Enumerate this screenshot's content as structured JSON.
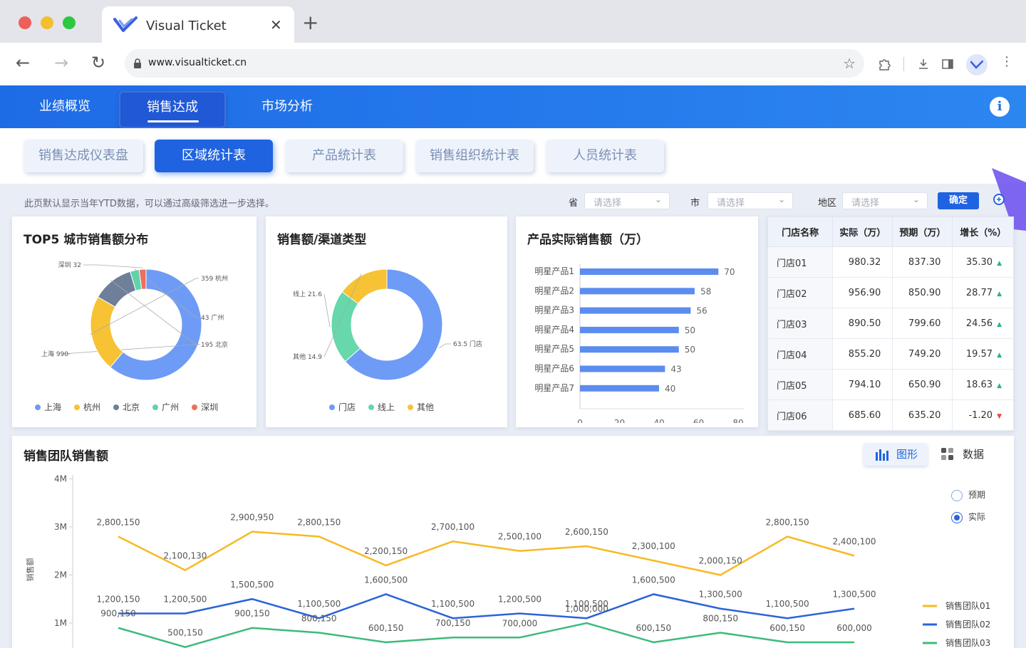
{
  "browser": {
    "tab_title": "Visual Ticket",
    "url": "www.visualticket.cn"
  },
  "nav": {
    "items": [
      "业绩概览",
      "销售达成",
      "市场分析"
    ],
    "active": 1
  },
  "subtabs": {
    "items": [
      "销售达成仪表盘",
      "区域统计表",
      "产品统计表",
      "销售组织统计表",
      "人员统计表"
    ],
    "active": 1
  },
  "filters": {
    "hint": "此页默认显示当年YTD数据，可以通过高级筛选进一步选择。",
    "province_label": "省",
    "city_label": "市",
    "district_label": "地区",
    "placeholder": "请选择",
    "confirm": "确定"
  },
  "cards": {
    "top5": {
      "title": "TOP5 城市销售额分布"
    },
    "channel": {
      "title": "销售额/渠道类型"
    },
    "product": {
      "title": "产品实际销售额（万）"
    }
  },
  "chart_data": [
    {
      "type": "pie",
      "title": "TOP5 城市销售额分布",
      "slices": [
        {
          "label": "上海",
          "value": 990,
          "color": "#6e9bf5"
        },
        {
          "label": "杭州",
          "value": 359,
          "color": "#f7c233"
        },
        {
          "label": "北京",
          "value": 195,
          "color": "#6f7f99"
        },
        {
          "label": "广州",
          "value": 43,
          "color": "#61d3a8"
        },
        {
          "label": "深圳",
          "value": 32,
          "color": "#ee6f5d"
        }
      ],
      "legend": [
        "上海",
        "杭州",
        "北京",
        "广州",
        "深圳"
      ]
    },
    {
      "type": "pie",
      "title": "销售额/渠道类型",
      "slices": [
        {
          "label": "门店",
          "value": 63.5,
          "color": "#6e9bf5"
        },
        {
          "label": "线上",
          "value": 21.6,
          "color": "#66d8aa"
        },
        {
          "label": "其他",
          "value": 14.9,
          "color": "#f7c233"
        }
      ],
      "legend": [
        "门店",
        "线上",
        "其他"
      ]
    },
    {
      "type": "bar",
      "title": "产品实际销售额（万）",
      "orientation": "horizontal",
      "categories": [
        "明星产品1",
        "明星产品2",
        "明星产品3",
        "明星产品4",
        "明星产品5",
        "明星产品6",
        "明星产品7"
      ],
      "values": [
        70,
        58,
        56,
        50,
        50,
        43,
        40
      ],
      "xlim": [
        0,
        80
      ],
      "ticks": [
        0,
        20,
        40,
        60,
        80
      ],
      "color": "#5b8cf0"
    },
    {
      "type": "line",
      "title": "销售团队销售额",
      "ylabel": "销售额",
      "yticks": [
        "4M",
        "3M",
        "2M",
        "1M"
      ],
      "series": [
        {
          "name": "销售团队01",
          "color": "#f7b924",
          "values": [
            2800150,
            2100130,
            2900950,
            2800150,
            2200150,
            2700100,
            2500100,
            2600150,
            2300100,
            2000150,
            2800150,
            2400100
          ],
          "labels": [
            "2,800,150",
            "2,100,130",
            "2,900,950",
            "2,800,150",
            "2,200,150",
            "2,700,100",
            "2,500,100",
            "2,600,150",
            "2,300,100",
            "2,000,150",
            "2,800,150",
            "2,400,100"
          ]
        },
        {
          "name": "销售团队02",
          "color": "#2b63d9",
          "values": [
            1200150,
            1200500,
            1500500,
            1100500,
            1600500,
            1100500,
            1200500,
            1100500,
            1600500,
            1300500,
            1100500,
            1300500
          ],
          "labels": [
            "1,200,150",
            "1,200,500",
            "1,500,500",
            "1,100,500",
            "1,600,500",
            "1,100,500",
            "1,200,500",
            "1,100,500",
            "1,600,500",
            "1,300,500",
            "1,100,500",
            "1,300,500"
          ]
        },
        {
          "name": "销售团队03",
          "color": "#3dbb7a",
          "values": [
            900150,
            500150,
            900150,
            800150,
            600150,
            700150,
            700000,
            1000000,
            600150,
            800150,
            600150,
            600000
          ],
          "labels": [
            "900,150",
            "500,150",
            "900,150",
            "800,150",
            "600,150",
            "700,150",
            "700,000",
            "1,000,000",
            "600,150",
            "800,150",
            "600,150",
            "600,000"
          ]
        }
      ]
    }
  ],
  "table": {
    "headers": [
      "门店名称",
      "实际（万）",
      "预期（万）",
      "增长（%）"
    ],
    "rows": [
      {
        "name": "门店01",
        "actual": "980.32",
        "expected": "837.30",
        "growth": "35.30",
        "trend": "up"
      },
      {
        "name": "门店02",
        "actual": "956.90",
        "expected": "850.90",
        "growth": "28.77",
        "trend": "up"
      },
      {
        "name": "门店03",
        "actual": "890.50",
        "expected": "799.60",
        "growth": "24.56",
        "trend": "up"
      },
      {
        "name": "门店04",
        "actual": "855.20",
        "expected": "749.20",
        "growth": "19.57",
        "trend": "up"
      },
      {
        "name": "门店05",
        "actual": "794.10",
        "expected": "650.90",
        "growth": "18.63",
        "trend": "up"
      },
      {
        "name": "门店06",
        "actual": "685.60",
        "expected": "635.20",
        "growth": "-1.20",
        "trend": "down"
      }
    ]
  },
  "bottom": {
    "title": "销售团队销售额",
    "view_chart": "图形",
    "view_data": "数据",
    "radio": {
      "options": [
        "预期",
        "实际"
      ],
      "selected": 1
    }
  },
  "colors": {
    "primary": "#1f63e0",
    "nav_gradient_start": "#1e6be6",
    "nav_gradient_end": "#2c86f0"
  },
  "icons": [
    "back-icon",
    "forward-icon",
    "reload-icon",
    "lock-icon",
    "star-icon",
    "extension-icon",
    "download-icon",
    "sidebar-icon",
    "profile-icon",
    "menu-icon",
    "info-icon",
    "zoom-in-icon",
    "bar-chart-icon",
    "grid-icon"
  ]
}
